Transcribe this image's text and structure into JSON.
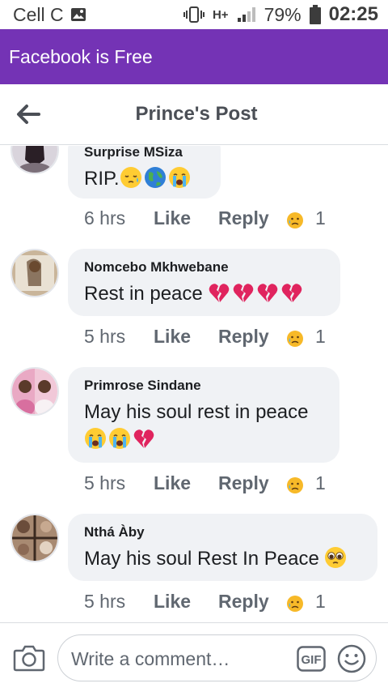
{
  "status_bar": {
    "carrier": "Cell C",
    "network": "H+",
    "battery": "79%",
    "time": "02:25"
  },
  "banner": {
    "text": "Facebook is Free"
  },
  "header": {
    "title": "Prince's Post"
  },
  "comments": [
    {
      "author": "Surprise MSiza",
      "text": "RIP.",
      "emojis": [
        "sleepy-face",
        "globe",
        "crying-face"
      ],
      "time": "6 hrs",
      "like": "Like",
      "reply": "Reply",
      "reaction": "sad",
      "reaction_count": "1"
    },
    {
      "author": "Nomcebo Mkhwebane",
      "text": "Rest in peace",
      "emojis": [
        "broken-heart",
        "broken-heart",
        "broken-heart",
        "broken-heart"
      ],
      "time": "5 hrs",
      "like": "Like",
      "reply": "Reply",
      "reaction": "sad",
      "reaction_count": "1"
    },
    {
      "author": "Primrose Sindane",
      "text": "May his soul rest in peace",
      "emojis": [
        "crying-face",
        "crying-face",
        "broken-heart"
      ],
      "time": "5 hrs",
      "like": "Like",
      "reply": "Reply",
      "reaction": "sad",
      "reaction_count": "1"
    },
    {
      "author": "Nthá Àby",
      "text": "May his soul Rest In Peace",
      "emojis": [
        "pleading-face"
      ],
      "time": "5 hrs",
      "like": "Like",
      "reply": "Reply",
      "reaction": "sad",
      "reaction_count": "1"
    }
  ],
  "composer": {
    "placeholder": "Write a comment…",
    "gif_label": "GIF"
  },
  "colors": {
    "banner": "#7433b5",
    "bubble": "#f0f2f5",
    "meta_text": "#606770"
  }
}
